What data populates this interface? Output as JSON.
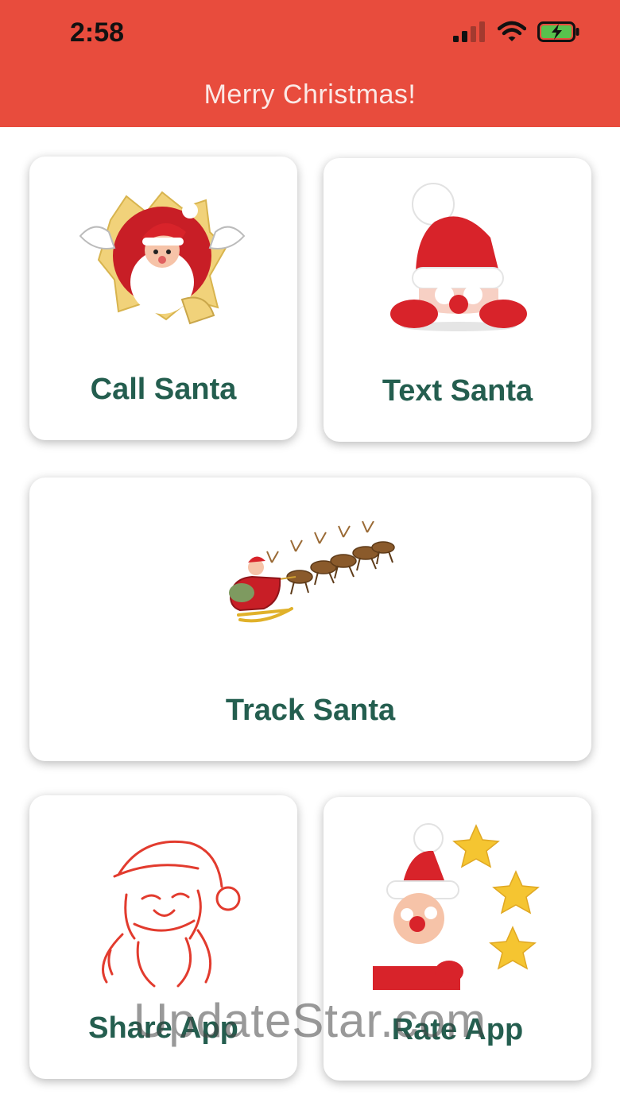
{
  "status_bar": {
    "time": "2:58"
  },
  "header": {
    "title": "Merry Christmas!"
  },
  "cards": {
    "call": {
      "label": "Call Santa"
    },
    "text": {
      "label": "Text Santa"
    },
    "track": {
      "label": "Track Santa"
    },
    "share": {
      "label": "Share App"
    },
    "rate": {
      "label": "Rate App"
    }
  },
  "watermark": "UpdateStar.com",
  "colors": {
    "header": "#e84c3d",
    "label": "#245e4f",
    "santa_red": "#d8232a",
    "star": "#f5c531"
  }
}
